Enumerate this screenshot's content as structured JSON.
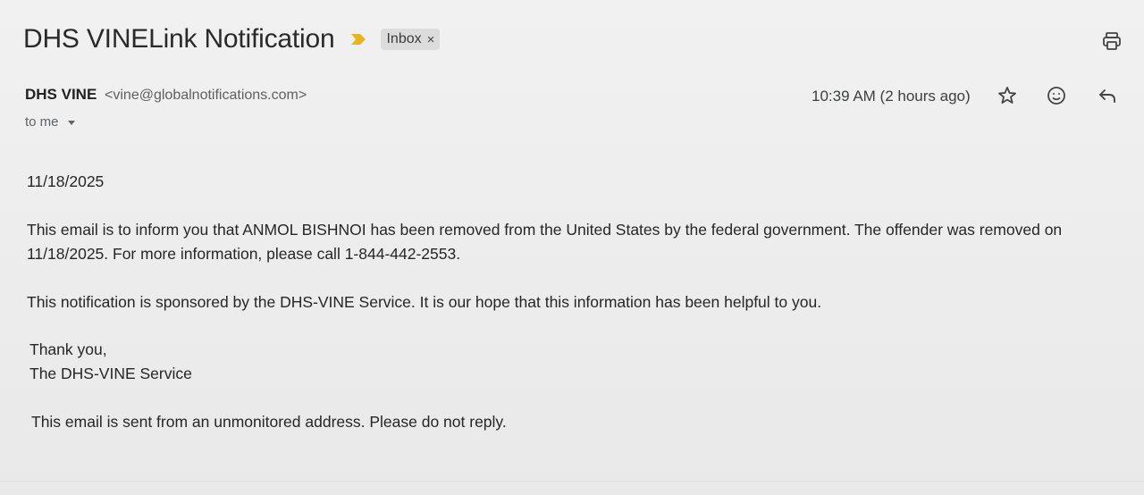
{
  "email": {
    "subject": "DHS VINELink Notification",
    "label": "Inbox",
    "label_close": "×",
    "sender_name": "DHS VINE",
    "sender_email": "<vine@globalnotifications.com>",
    "recipient": "to me",
    "timestamp": "10:39 AM (2 hours ago)",
    "body": {
      "date": "11/18/2025",
      "paragraph1": "This email is to inform you that ANMOL BISHNOI has been removed from the United States by the federal government. The offender was removed on 11/18/2025. For more information, please call 1-844-442-2553.",
      "paragraph2": "This notification is sponsored by the DHS-VINE Service. It is our hope that this information has been helpful to you.",
      "closing": "Thank you,",
      "signature": "The DHS-VINE Service",
      "footer": "This email is sent from an unmonitored address. Please do not reply."
    }
  },
  "icons": {
    "important": "important-marker-icon",
    "print": "print-icon",
    "star": "star-icon",
    "emoji": "emoji-reaction-icon",
    "reply": "reply-icon",
    "dropdown": "chevron-down-icon"
  },
  "colors": {
    "important_marker": "#e8b325",
    "background": "#eeeeee",
    "text": "#262626"
  }
}
